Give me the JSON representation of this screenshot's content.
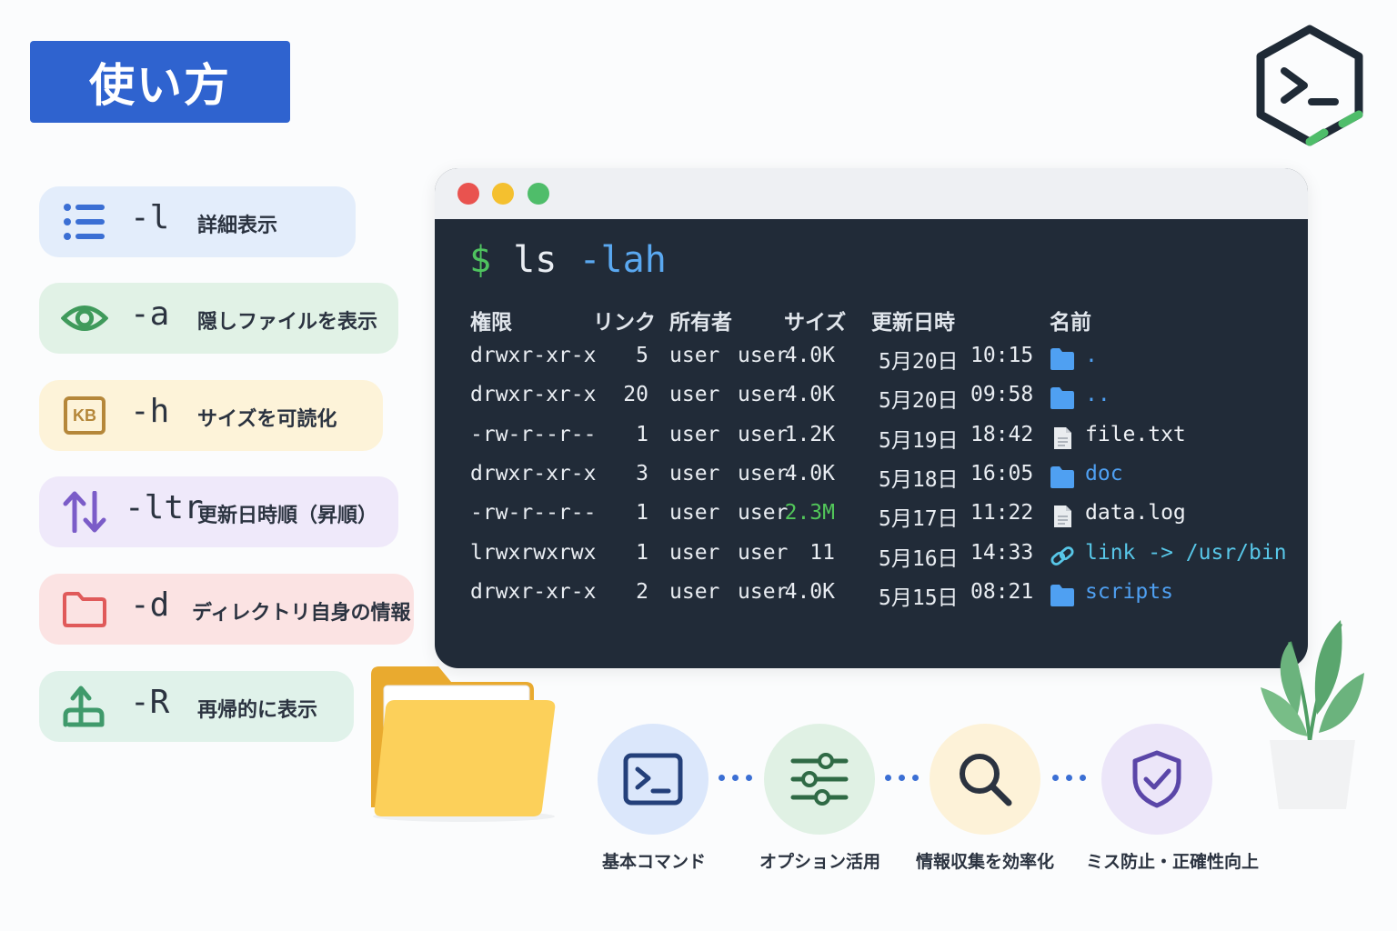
{
  "title": "使い方",
  "options": [
    {
      "icon": "list-icon",
      "flag": "-l",
      "desc": "詳細表示",
      "bg": "#e3edfb"
    },
    {
      "icon": "eye-icon",
      "flag": "-a",
      "desc": "隠しファイルを表示",
      "bg": "#e1f2e6"
    },
    {
      "icon": "kb-icon",
      "icon_text": "KB",
      "flag": "-h",
      "desc": "サイズを可読化",
      "bg": "#fdf3d9"
    },
    {
      "icon": "sort-arrows-icon",
      "flag": "-ltr",
      "desc": "更新日時順（昇順）",
      "bg": "#efe9fa"
    },
    {
      "icon": "folder-icon",
      "flag": "-d",
      "desc": "ディレクトリ自身の情報",
      "bg": "#fbe3e3"
    },
    {
      "icon": "recursive-icon",
      "flag": "-R",
      "desc": "再帰的に表示",
      "bg": "#e0f2ea"
    }
  ],
  "terminal": {
    "prompt_symbol": "$",
    "command": "ls",
    "command_flag": "-lah",
    "headers": {
      "perm": "権限",
      "links": "リンク",
      "owner": "所有者",
      "size": "サイズ",
      "mtime": "更新日時",
      "name": "名前"
    },
    "rows": [
      {
        "perm": "drwxr-xr-x",
        "links": "5",
        "user": "user",
        "group": "user",
        "size": "4.0K",
        "date": "5月20日",
        "time": "10:15",
        "icon": "folder-icon",
        "name": "."
      },
      {
        "perm": "drwxr-xr-x",
        "links": "20",
        "user": "user",
        "group": "user",
        "size": "4.0K",
        "date": "5月20日",
        "time": "09:58",
        "icon": "folder-icon",
        "name": ".."
      },
      {
        "perm": "-rw-r--r--",
        "links": "1",
        "user": "user",
        "group": "user",
        "size": "1.2K",
        "date": "5月19日",
        "time": "18:42",
        "icon": "file-icon",
        "name": "file.txt"
      },
      {
        "perm": "drwxr-xr-x",
        "links": "3",
        "user": "user",
        "group": "user",
        "size": "4.0K",
        "date": "5月18日",
        "time": "16:05",
        "icon": "folder-icon",
        "name": "doc"
      },
      {
        "perm": "-rw-r--r--",
        "links": "1",
        "user": "user",
        "group": "user",
        "size": "2.3M",
        "date": "5月17日",
        "time": "11:22",
        "icon": "file-icon",
        "name": "data.log"
      },
      {
        "perm": "lrwxrwxrwx",
        "links": "1",
        "user": "user",
        "group": "user",
        "size": "11",
        "date": "5月16日",
        "time": "14:33",
        "icon": "link-icon",
        "name": "link -> /usr/bin"
      },
      {
        "perm": "drwxr-xr-x",
        "links": "2",
        "user": "user",
        "group": "user",
        "size": "4.0K",
        "date": "5月15日",
        "time": "08:21",
        "icon": "folder-icon",
        "name": "scripts"
      }
    ]
  },
  "features": [
    {
      "icon": "terminal-icon",
      "label": "基本コマンド",
      "bg": "#dbe7fb"
    },
    {
      "icon": "sliders-icon",
      "label": "オプション活用",
      "bg": "#e0f1e4"
    },
    {
      "icon": "magnifier-icon",
      "label": "情報収集を効率化",
      "bg": "#fdf2d8"
    },
    {
      "icon": "shield-check-icon",
      "label": "ミス防止・正確性向上",
      "bg": "#ece6f9"
    }
  ],
  "colors": {
    "accent": "#2f63cf",
    "terminal_bg": "#212b38",
    "prompt_green": "#4fc35f",
    "flag_blue": "#5aa8f0",
    "dir_blue": "#4fa0f2",
    "link_cyan": "#58c7e8",
    "size_highlight": "#52c75a",
    "window_close": "#e9534f",
    "window_min": "#f4c02f",
    "window_max": "#4fbd6a"
  }
}
